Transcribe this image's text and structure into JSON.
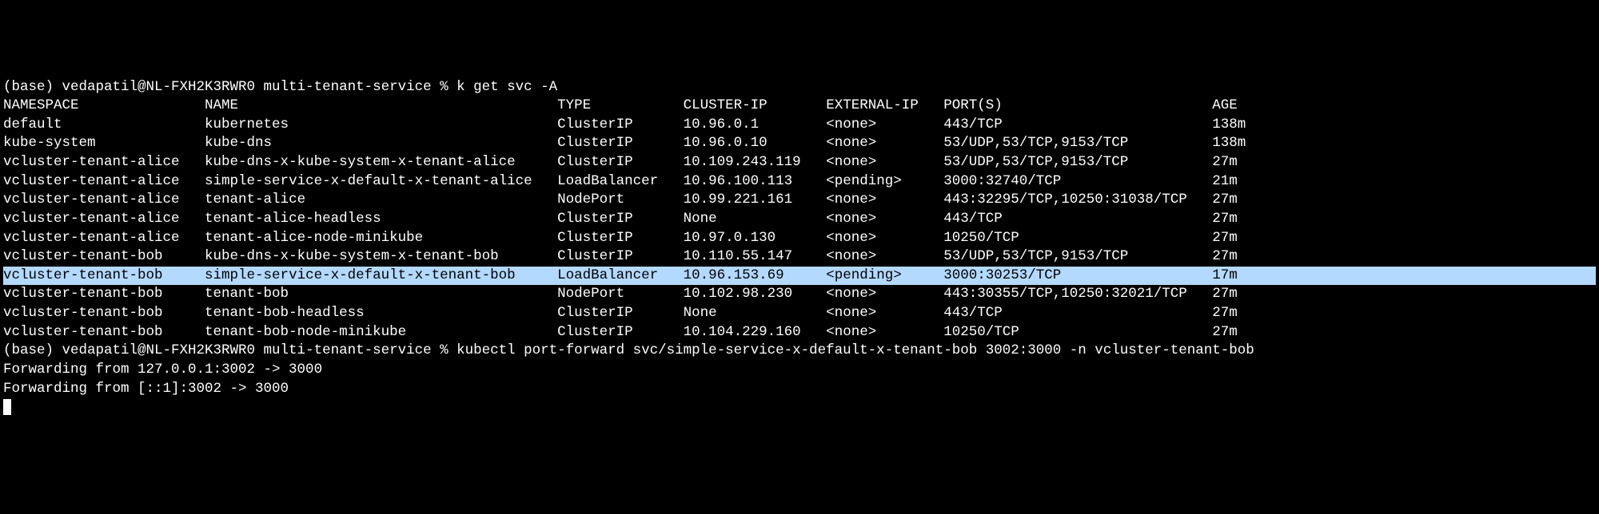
{
  "prompt1": "(base) vedapatil@NL-FXH2K3RWR0 multi-tenant-service % ",
  "cmd1": "k get svc -A",
  "headers": {
    "namespace": "NAMESPACE",
    "name": "NAME",
    "type": "TYPE",
    "cluster_ip": "CLUSTER-IP",
    "external_ip": "EXTERNAL-IP",
    "ports": "PORT(S)",
    "age": "AGE"
  },
  "rows": [
    {
      "namespace": "default",
      "name": "kubernetes",
      "type": "ClusterIP",
      "cluster_ip": "10.96.0.1",
      "external_ip": "<none>",
      "ports": "443/TCP",
      "age": "138m",
      "hl": false
    },
    {
      "namespace": "kube-system",
      "name": "kube-dns",
      "type": "ClusterIP",
      "cluster_ip": "10.96.0.10",
      "external_ip": "<none>",
      "ports": "53/UDP,53/TCP,9153/TCP",
      "age": "138m",
      "hl": false
    },
    {
      "namespace": "vcluster-tenant-alice",
      "name": "kube-dns-x-kube-system-x-tenant-alice",
      "type": "ClusterIP",
      "cluster_ip": "10.109.243.119",
      "external_ip": "<none>",
      "ports": "53/UDP,53/TCP,9153/TCP",
      "age": "27m",
      "hl": false
    },
    {
      "namespace": "vcluster-tenant-alice",
      "name": "simple-service-x-default-x-tenant-alice",
      "type": "LoadBalancer",
      "cluster_ip": "10.96.100.113",
      "external_ip": "<pending>",
      "ports": "3000:32740/TCP",
      "age": "21m",
      "hl": false
    },
    {
      "namespace": "vcluster-tenant-alice",
      "name": "tenant-alice",
      "type": "NodePort",
      "cluster_ip": "10.99.221.161",
      "external_ip": "<none>",
      "ports": "443:32295/TCP,10250:31038/TCP",
      "age": "27m",
      "hl": false
    },
    {
      "namespace": "vcluster-tenant-alice",
      "name": "tenant-alice-headless",
      "type": "ClusterIP",
      "cluster_ip": "None",
      "external_ip": "<none>",
      "ports": "443/TCP",
      "age": "27m",
      "hl": false
    },
    {
      "namespace": "vcluster-tenant-alice",
      "name": "tenant-alice-node-minikube",
      "type": "ClusterIP",
      "cluster_ip": "10.97.0.130",
      "external_ip": "<none>",
      "ports": "10250/TCP",
      "age": "27m",
      "hl": false
    },
    {
      "namespace": "vcluster-tenant-bob",
      "name": "kube-dns-x-kube-system-x-tenant-bob",
      "type": "ClusterIP",
      "cluster_ip": "10.110.55.147",
      "external_ip": "<none>",
      "ports": "53/UDP,53/TCP,9153/TCP",
      "age": "27m",
      "hl": false
    },
    {
      "namespace": "vcluster-tenant-bob",
      "name": "simple-service-x-default-x-tenant-bob",
      "type": "LoadBalancer",
      "cluster_ip": "10.96.153.69",
      "external_ip": "<pending>",
      "ports": "3000:30253/TCP",
      "age": "17m",
      "hl": true
    },
    {
      "namespace": "vcluster-tenant-bob",
      "name": "tenant-bob",
      "type": "NodePort",
      "cluster_ip": "10.102.98.230",
      "external_ip": "<none>",
      "ports": "443:30355/TCP,10250:32021/TCP",
      "age": "27m",
      "hl": false
    },
    {
      "namespace": "vcluster-tenant-bob",
      "name": "tenant-bob-headless",
      "type": "ClusterIP",
      "cluster_ip": "None",
      "external_ip": "<none>",
      "ports": "443/TCP",
      "age": "27m",
      "hl": false
    },
    {
      "namespace": "vcluster-tenant-bob",
      "name": "tenant-bob-node-minikube",
      "type": "ClusterIP",
      "cluster_ip": "10.104.229.160",
      "external_ip": "<none>",
      "ports": "10250/TCP",
      "age": "27m",
      "hl": false
    }
  ],
  "prompt2": "(base) vedapatil@NL-FXH2K3RWR0 multi-tenant-service % ",
  "cmd2": "kubectl port-forward svc/simple-service-x-default-x-tenant-bob 3002:3000 -n vcluster-tenant-bob",
  "fwd1": "Forwarding from 127.0.0.1:3002 -> 3000",
  "fwd2": "Forwarding from [::1]:3002 -> 3000"
}
